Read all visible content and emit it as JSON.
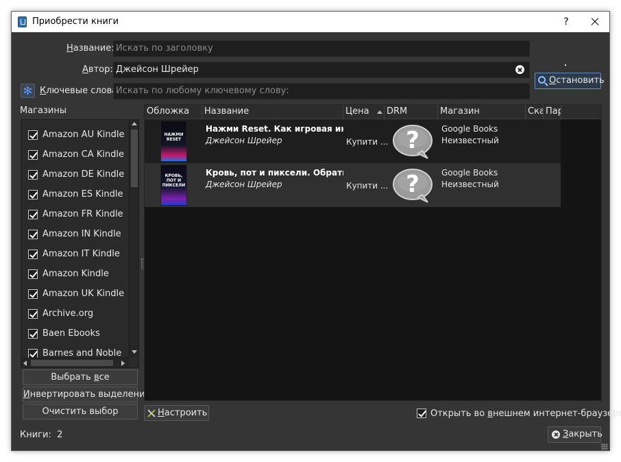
{
  "window": {
    "title": "Приобрести книги",
    "help_glyph": "?"
  },
  "search": {
    "title_label_prefix": "",
    "title_label_underlined": "Н",
    "title_label_rest": "азвание:",
    "title_placeholder": "Искать по заголовку",
    "author_label_underlined": "А",
    "author_label_rest": "втор:",
    "author_value": "Джейсон Шрейер",
    "keywords_label_underlined": "К",
    "keywords_label_rest": "лючевые слова:",
    "keywords_placeholder": "Искать по любому ключевому слову:",
    "stop_label_underlined": "О",
    "stop_label_rest": "становить"
  },
  "stores": {
    "title": "Магазины",
    "items": [
      {
        "label": "Amazon AU Kindle",
        "checked": true
      },
      {
        "label": "Amazon CA Kindle",
        "checked": true
      },
      {
        "label": "Amazon DE Kindle",
        "checked": true
      },
      {
        "label": "Amazon ES Kindle",
        "checked": true
      },
      {
        "label": "Amazon FR Kindle",
        "checked": true
      },
      {
        "label": "Amazon IN Kindle",
        "checked": true
      },
      {
        "label": "Amazon IT Kindle",
        "checked": true
      },
      {
        "label": "Amazon Kindle",
        "checked": true
      },
      {
        "label": "Amazon UK Kindle",
        "checked": true
      },
      {
        "label": "Archive.org",
        "checked": true
      },
      {
        "label": "Baen Ebooks",
        "checked": true
      },
      {
        "label": "Barnes and Noble",
        "checked": true
      }
    ],
    "select_all_prefix": "Выбрать ",
    "select_all_underlined": "в",
    "select_all_rest": "се",
    "invert_underlined": "И",
    "invert_rest": "нвертировать выделение",
    "clear_label": "Очистить выбор"
  },
  "results": {
    "columns": [
      "Обложка",
      "Название",
      "Цена",
      "DRM",
      "Магазин",
      "Ска",
      "Пар"
    ],
    "rows": [
      {
        "cover_text": "НАЖМИ\nRESET",
        "title": "Нажми Reset. Как игровая индустрия",
        "author": "Джейсон Шрейер",
        "price": "Купити ...",
        "store": "Google Books",
        "drm_status": "Неизвестный"
      },
      {
        "cover_text": "КРОВЬ,\nПОТ И\nПИКСЕЛИ",
        "title": "Кровь, пот и пиксели. Обратная",
        "author": "Джейсон Шрейер",
        "price": "Купити ...",
        "store": "Google Books",
        "drm_status": "Неизвестный"
      }
    ]
  },
  "footer": {
    "configure_underlined": "Н",
    "configure_rest": "астроить",
    "open_external_prefix": "Открыть во ",
    "open_external_underlined": "в",
    "open_external_rest": "нешнем интернет-браузере",
    "open_external_checked": true,
    "books_count_label": "Книги:",
    "books_count_value": "2",
    "close_underlined": "З",
    "close_rest": "акрыть"
  },
  "colors": {
    "window_bg": "#353535",
    "input_bg": "#1e1e1e",
    "accent": "#5c8fd6"
  }
}
